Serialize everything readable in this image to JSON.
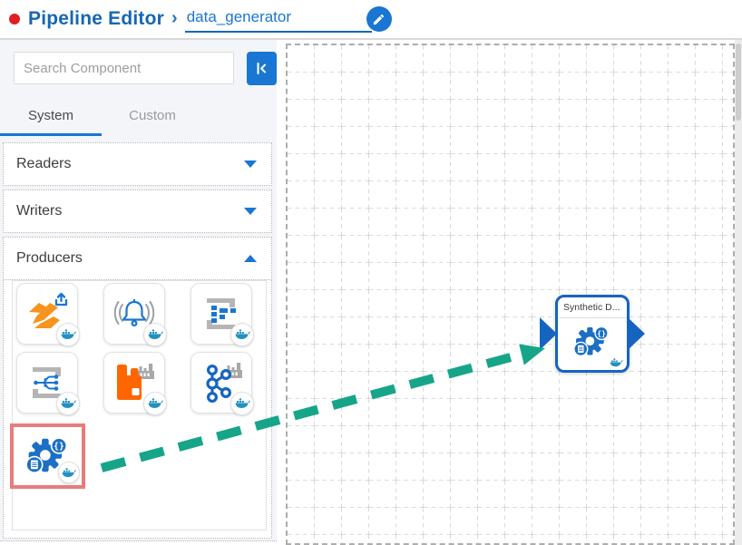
{
  "header": {
    "status_dot": "recording-indicator",
    "title": "Pipeline Editor",
    "separator": "›",
    "pipeline_name": "data_generator",
    "edit_button_icon": "pencil-icon"
  },
  "sidebar": {
    "search": {
      "placeholder": "Search Component",
      "value": ""
    },
    "collapse_button_icon": "collapse-panel-left-icon",
    "tabs": [
      {
        "label": "System",
        "active": true
      },
      {
        "label": "Custom",
        "active": false
      }
    ],
    "sections": [
      {
        "label": "Readers",
        "expanded": false
      },
      {
        "label": "Writers",
        "expanded": false
      },
      {
        "label": "Producers",
        "expanded": true
      }
    ],
    "producers_components": [
      {
        "icon": "data-publisher-icon",
        "badge": "docker-whale-icon",
        "selected": false
      },
      {
        "icon": "alert-bell-icon",
        "badge": "docker-whale-icon",
        "selected": false
      },
      {
        "icon": "structured-output-icon",
        "badge": "docker-whale-icon",
        "selected": false
      },
      {
        "icon": "stream-split-icon",
        "badge": "docker-whale-icon",
        "selected": false
      },
      {
        "icon": "rabbitmq-icon",
        "badge": "docker-whale-icon",
        "selected": false
      },
      {
        "icon": "kafka-icon",
        "badge": "docker-whale-icon",
        "selected": false
      },
      {
        "icon": "synthetic-data-generator-icon",
        "badge": "docker-whale-icon",
        "selected": true
      }
    ]
  },
  "canvas": {
    "node": {
      "title": "Synthetic D...",
      "icon": "synthetic-data-generator-icon",
      "badge": "docker-whale-icon",
      "ports": [
        "input-port",
        "output-port"
      ]
    },
    "drag_arrow": "drag-drop-arrow"
  },
  "colors": {
    "accent_blue": "#1976d2",
    "dark_blue": "#1565c0",
    "arrow_green": "#17a589",
    "highlight_red": "#e87c7c",
    "publisher_orange": "#f7941d",
    "rabbitmq_orange": "#ff6600",
    "docker_blue": "#2191c0",
    "grid_gray": "#c6c6c6",
    "status_red": "#e02020"
  }
}
